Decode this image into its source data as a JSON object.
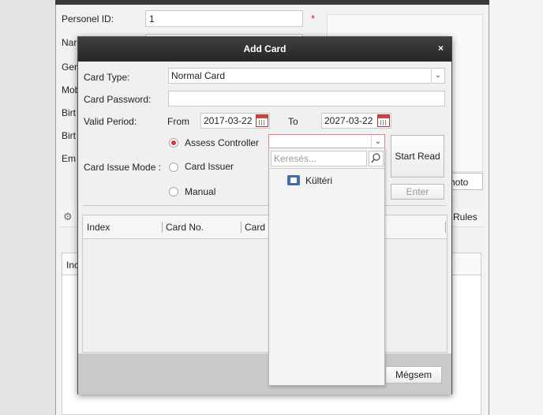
{
  "background_form": {
    "fields": [
      {
        "label": "Personel ID:",
        "value": "1"
      },
      {
        "label": "Nar"
      },
      {
        "label": "Ger"
      },
      {
        "label": "Mob"
      },
      {
        "label": "Birt"
      },
      {
        "label": "Birt"
      },
      {
        "label": "Em"
      }
    ],
    "required_mark": "*",
    "photo_button": "hoto",
    "rules_tab": "Rules",
    "grid_header_first": "Inc"
  },
  "dialog": {
    "title": "Add Card",
    "close_symbol": "×",
    "card_type_label": "Card Type:",
    "card_type_value": "Normal Card",
    "card_password_label": "Card Password:",
    "card_password_value": "",
    "valid_period_label": "Valid Period:",
    "from_label": "From",
    "from_value": "2017-03-22",
    "to_label": "To",
    "to_value": "2027-03-22",
    "issue_mode_label": "Card Issue Mode :",
    "modes": [
      {
        "label": "Assess Controller",
        "checked": true
      },
      {
        "label": "Card Issuer",
        "checked": false
      },
      {
        "label": "Manual",
        "checked": false
      }
    ],
    "controller_value": "",
    "start_read_button": "Start Read",
    "enter_button": "Enter",
    "table_columns": [
      "Index",
      "Card No.",
      "Card"
    ],
    "cancel_button": "Mégsem"
  },
  "dropdown_popup": {
    "search_placeholder": "Keresés...",
    "items": [
      {
        "label": "Kültéri",
        "icon": "access-controller-icon"
      }
    ]
  },
  "colors": {
    "titlebar": "#2e2e2e",
    "required": "#dd2222",
    "radio_selected": "#dd3333",
    "field_error_border": "#e08080"
  }
}
